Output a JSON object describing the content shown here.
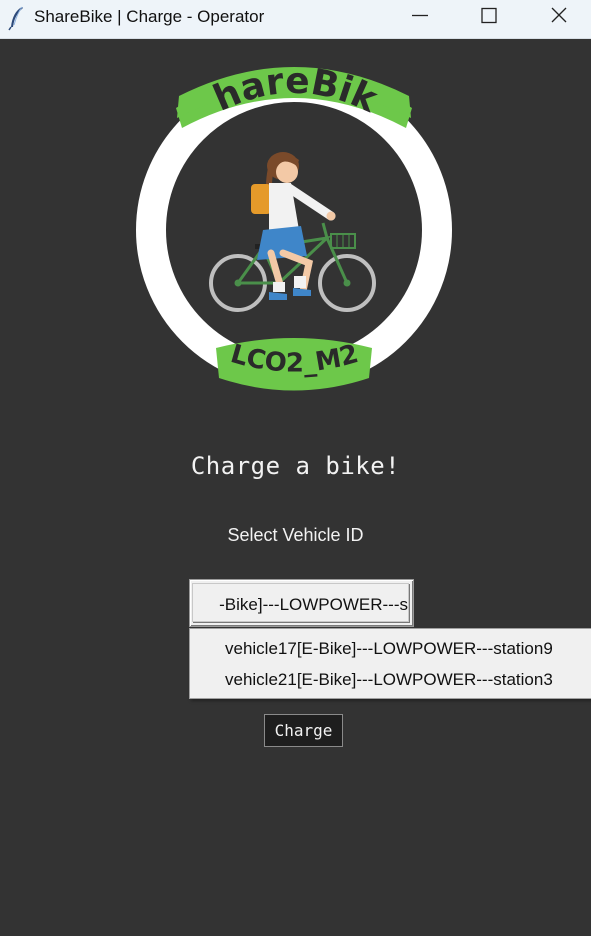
{
  "window": {
    "title": "ShareBike | Charge - Operator",
    "controls": {
      "minimize_icon": "minimize-icon",
      "maximize_icon": "maximize-icon",
      "close_icon": "close-icon"
    }
  },
  "logo": {
    "brand": "ShareBike",
    "subtitle": "LCO2_M2",
    "ring_color": "#ffffff",
    "badge_color": "#6dc84a",
    "inner_color": "#333333"
  },
  "main": {
    "heading": "Charge a bike!",
    "select_label": "Select Vehicle ID",
    "vehicle_select": {
      "display_value": "-Bike]---LOWPOWER---s",
      "options": [
        "vehicle17[E-Bike]---LOWPOWER---station9",
        "vehicle21[E-Bike]---LOWPOWER---station3"
      ]
    },
    "charge_button": "Charge"
  },
  "colors": {
    "background": "#333333",
    "titlebar": "#eef4f9",
    "text_light": "#f2f2f2"
  }
}
